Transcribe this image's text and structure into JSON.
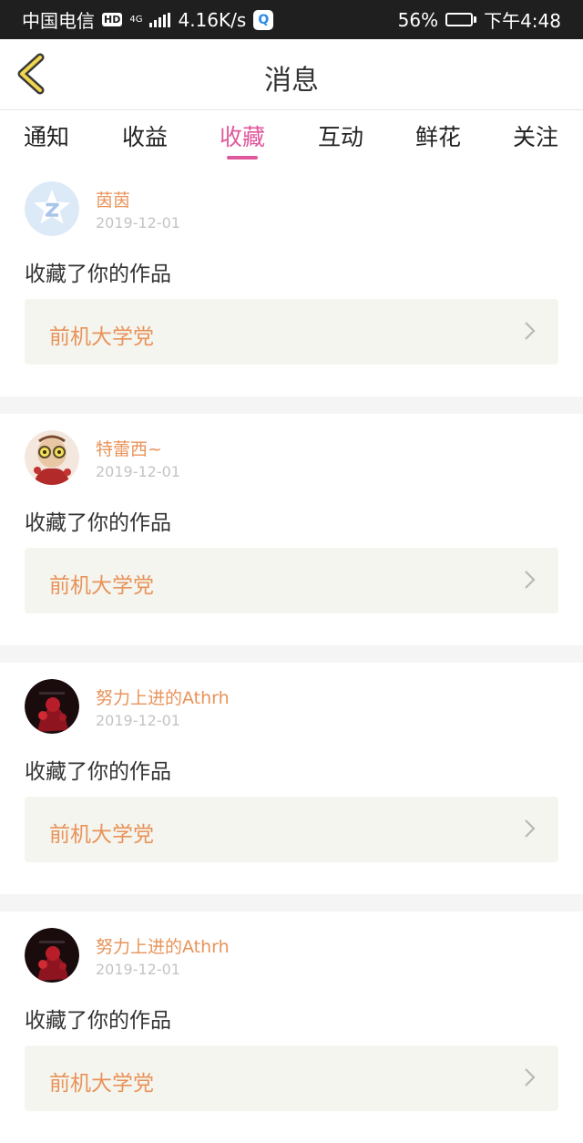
{
  "status_bar": {
    "carrier": "中国电信",
    "hd": "HD",
    "network": "4G",
    "speed": "4.16K/s",
    "app_icon_glyph": "Q",
    "battery": "56%",
    "battery_level": 0.56,
    "time": "下午4:48"
  },
  "nav": {
    "title": "消息"
  },
  "tabs": [
    {
      "label": "通知"
    },
    {
      "label": "收益"
    },
    {
      "label": "收藏"
    },
    {
      "label": "互动"
    },
    {
      "label": "鲜花"
    },
    {
      "label": "关注"
    }
  ],
  "active_tab": 2,
  "items": [
    {
      "name": "茵茵",
      "date": "2019-12-01",
      "action": "收藏了你的作品",
      "work": "前机大学党",
      "avatar": "default-z"
    },
    {
      "name": "特蕾西~",
      "date": "2019-12-01",
      "action": "收藏了你的作品",
      "work": "前机大学党",
      "avatar": "illustration"
    },
    {
      "name": "努力上进的Athrh",
      "date": "2019-12-01",
      "action": "收藏了你的作品",
      "work": "前机大学党",
      "avatar": "dark-red"
    },
    {
      "name": "努力上进的Athrh",
      "date": "2019-12-01",
      "action": "收藏了你的作品",
      "work": "前机大学党",
      "avatar": "dark-red"
    }
  ],
  "colors": {
    "accent": "#e0589c",
    "name": "#e8935a",
    "card_bg": "#f5f5ef"
  }
}
